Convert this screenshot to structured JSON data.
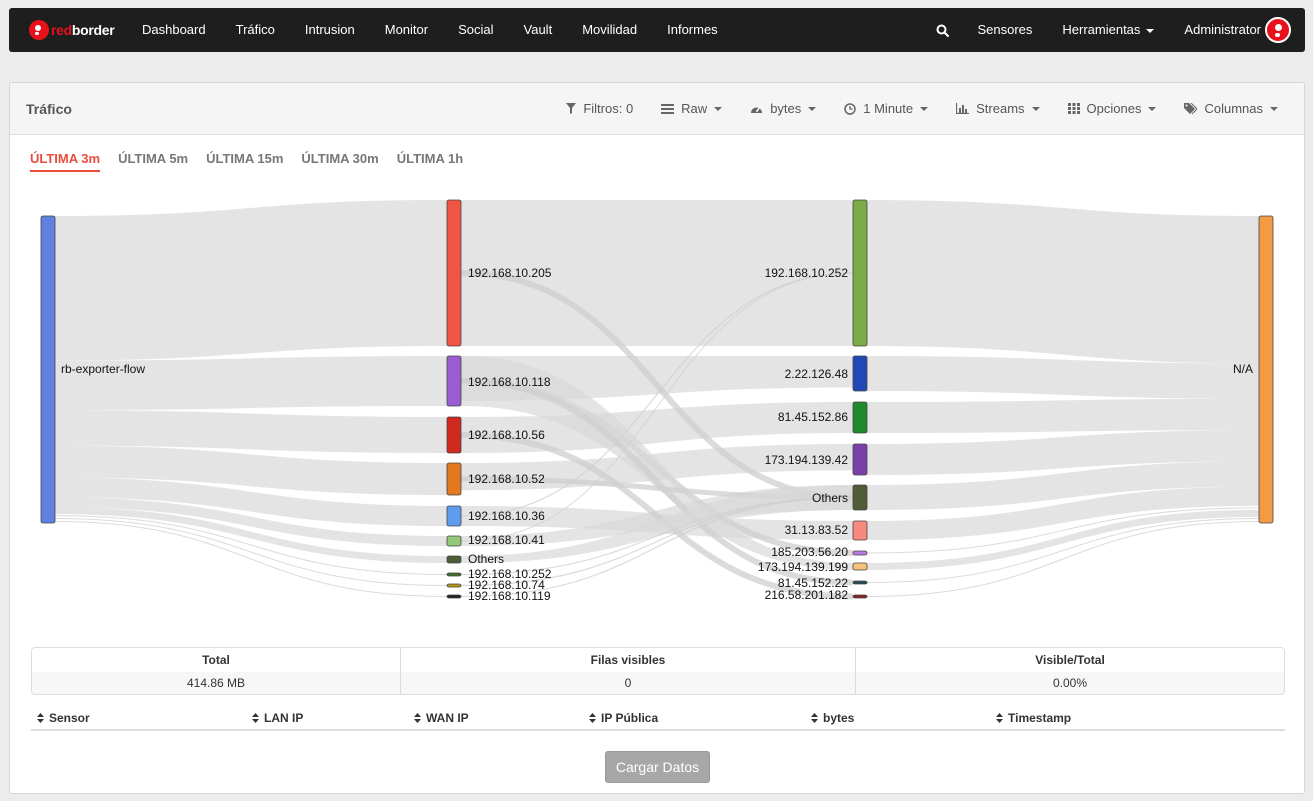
{
  "brand": {
    "part1": "red",
    "part2": "border"
  },
  "nav": {
    "items": [
      "Dashboard",
      "Tráfico",
      "Intrusion",
      "Monitor",
      "Social",
      "Vault",
      "Movilidad",
      "Informes"
    ],
    "sensores": "Sensores",
    "herramientas": "Herramientas",
    "user": "Administrator"
  },
  "panel": {
    "title": "Tráfico",
    "toolbar": {
      "filtros": "Filtros: 0",
      "raw": "Raw",
      "bytes": "bytes",
      "interval": "1 Minute",
      "streams": "Streams",
      "opciones": "Opciones",
      "columnas": "Columnas"
    }
  },
  "time_tabs": [
    "ÚLTIMA 3m",
    "ÚLTIMA 5m",
    "ÚLTIMA 15m",
    "ÚLTIMA 30m",
    "ÚLTIMA 1h"
  ],
  "sankey": {
    "source": {
      "label": "rb-exporter-flow",
      "color": "#6181e0"
    },
    "lan": [
      {
        "label": "192.168.10.205",
        "color": "#f05545"
      },
      {
        "label": "192.168.10.118",
        "color": "#9b5bd1"
      },
      {
        "label": "192.168.10.56",
        "color": "#d0291f"
      },
      {
        "label": "192.168.10.52",
        "color": "#e2791e"
      },
      {
        "label": "192.168.10.36",
        "color": "#5f9bef"
      },
      {
        "label": "192.168.10.41",
        "color": "#95c77c"
      },
      {
        "label": "Others",
        "color": "#4d5c37"
      },
      {
        "label": "192.168.10.252",
        "color": "#3f6b2b"
      },
      {
        "label": "192.168.10.74",
        "color": "#b49a1b"
      },
      {
        "label": "192.168.10.119",
        "color": "#222222"
      }
    ],
    "wan": [
      {
        "label": "192.168.10.252",
        "color": "#7aab45"
      },
      {
        "label": "2.22.126.48",
        "color": "#2049b5"
      },
      {
        "label": "81.45.152.86",
        "color": "#1f8a2b"
      },
      {
        "label": "173.194.139.42",
        "color": "#7b3fa8"
      },
      {
        "label": "Others",
        "color": "#505c38"
      },
      {
        "label": "31.13.83.52",
        "color": "#f8897f"
      },
      {
        "label": "185.203.56.20",
        "color": "#b97be0"
      },
      {
        "label": "173.194.139.199",
        "color": "#f6c27a"
      },
      {
        "label": "81.45.152.22",
        "color": "#214d55"
      },
      {
        "label": "216.58.201.182",
        "color": "#8c1f1f"
      }
    ],
    "target": {
      "label": "N/A",
      "color": "#f29b43"
    }
  },
  "summary": {
    "total_label": "Total",
    "total_value": "414.86 MB",
    "rows_label": "Filas visibles",
    "rows_value": "0",
    "ratio_label": "Visible/Total",
    "ratio_value": "0.00%"
  },
  "table": {
    "columns": [
      "Sensor",
      "LAN IP",
      "WAN IP",
      "IP Pública",
      "bytes",
      "Timestamp"
    ]
  },
  "load_button": "Cargar Datos"
}
